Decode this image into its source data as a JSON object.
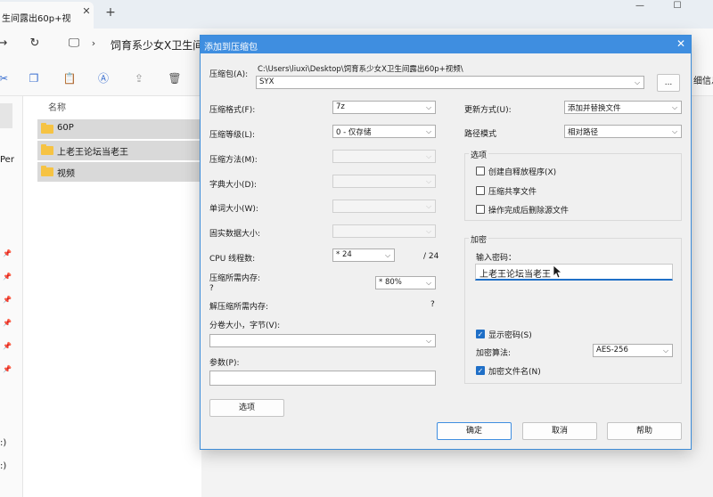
{
  "explorer": {
    "tab_title": "生间露出60p+视",
    "tab_close": "✕",
    "tab_new": "+",
    "window_controls": [
      "—",
      "☐"
    ],
    "address_path": "饲育系少女X卫生间",
    "toolbar_right": "细信息",
    "sidebar_texts": [
      "Per",
      ":)",
      ":)"
    ],
    "column_name": "名称",
    "files": [
      "60P",
      "上老王论坛当老王",
      "视频"
    ]
  },
  "dialog": {
    "title": "添加到压缩包",
    "close": "✕",
    "archive_label": "压缩包(A):",
    "archive_path": "C:\\Users\\liuxi\\Desktop\\饲育系少女X卫生间露出60p+视频\\",
    "archive_name": "SYX",
    "browse_label": "...",
    "left": {
      "format_label": "压缩格式(F):",
      "format_value": "7z",
      "level_label": "压缩等级(L):",
      "level_value": "0 - 仅存储",
      "method_label": "压缩方法(M):",
      "dict_label": "字典大小(D):",
      "word_label": "单词大小(W):",
      "solid_label": "固实数据大小:",
      "cpu_label": "CPU 线程数:",
      "cpu_value": "* 24",
      "cpu_total": "/ 24",
      "mem_label": "压缩所需内存:",
      "mem_value": "?",
      "mem_percent": "* 80%",
      "decomp_label": "解压缩所需内存:",
      "decomp_value": "?",
      "split_label": "分卷大小，字节(V):",
      "split_value": "",
      "params_label": "参数(P):",
      "params_value": "",
      "options_button": "选项"
    },
    "right": {
      "update_label": "更新方式(U):",
      "update_value": "添加并替换文件",
      "path_label": "路径模式",
      "path_value": "相对路径",
      "options_group": "选项",
      "opt_sfx": "创建自释放程序(X)",
      "opt_shared": "压缩共享文件",
      "opt_delete": "操作完成后删除源文件",
      "encrypt_group": "加密",
      "password_label": "输入密码：",
      "password_value": "上老王论坛当老王",
      "show_password": "显示密码(S)",
      "algo_label": "加密算法:",
      "algo_value": "AES-256",
      "encrypt_names": "加密文件名(N)"
    },
    "buttons": {
      "ok": "确定",
      "cancel": "取消",
      "help": "帮助"
    }
  }
}
